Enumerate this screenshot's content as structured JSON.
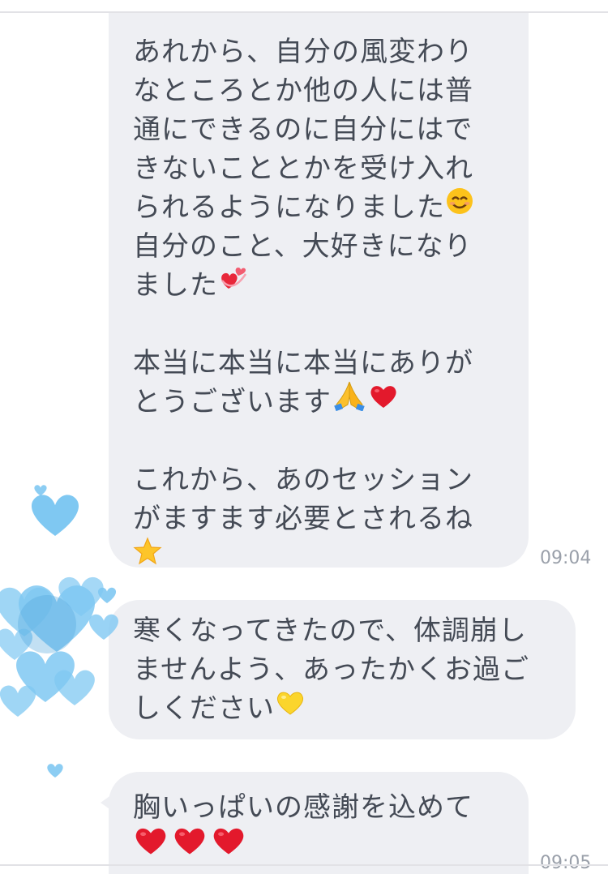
{
  "messages": [
    {
      "lines": [
        "あれから、自分の風変わり",
        "なところとか他の人には普",
        "通にできるのに自分にはで",
        "きないこととかを受け入れ",
        "られるようになりました",
        "自分のこと、大好きになり",
        "ました",
        "",
        "本当に本当に本当にありが",
        "とうございます",
        "",
        "これから、あのセッション",
        "がますます必要とされるね",
        ""
      ],
      "time": "09:04"
    },
    {
      "lines": [
        "寒くなってきたので、体調崩し",
        "ませんよう、あったかくお過ご",
        "しください"
      ]
    },
    {
      "lines": [
        "胸いっぱいの感謝を込めて",
        ""
      ],
      "time": "09:05"
    }
  ],
  "icons": {
    "smile": "smiling-face-icon",
    "hearts": "revolving-hearts-icon",
    "pray": "folded-hands-icon",
    "red_heart": "red-heart-icon",
    "star": "star-icon",
    "yellow_heart": "yellow-heart-icon"
  },
  "colors": {
    "bubble": "#eeeff3",
    "text": "#444a55",
    "timestamp": "#9aa0aa",
    "avatar_hearts": "#7fc8f2"
  }
}
